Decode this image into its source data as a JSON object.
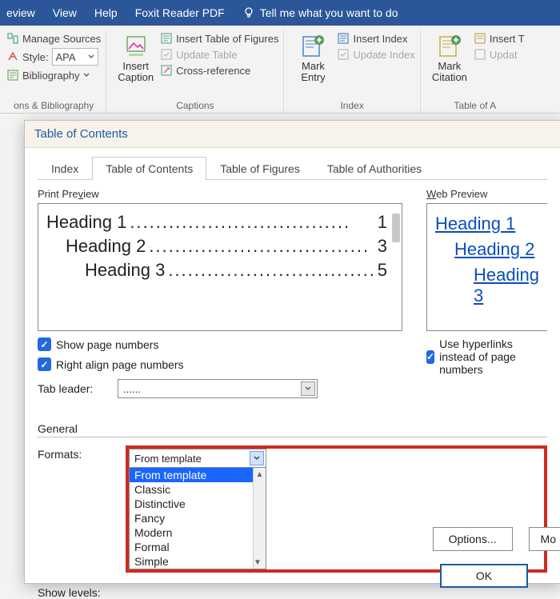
{
  "menubar": {
    "review": "eview",
    "view": "View",
    "help": "Help",
    "foxit": "Foxit Reader PDF",
    "tellme": "Tell me what you want to do"
  },
  "ribbon": {
    "citations": {
      "manage_sources": "Manage Sources",
      "style_label": "Style:",
      "style_value": "APA",
      "bibliography": "Bibliography",
      "group": "ons & Bibliography"
    },
    "captions": {
      "insert_caption_top": "Insert",
      "insert_caption_bot": "Caption",
      "insert_table": "Insert Table of Figures",
      "update_table": "Update Table",
      "cross_ref": "Cross-reference",
      "group": "Captions"
    },
    "index": {
      "mark_entry_top": "Mark",
      "mark_entry_bot": "Entry",
      "insert_index": "Insert Index",
      "update_index": "Update Index",
      "group": "Index"
    },
    "authorities": {
      "mark_citation_top": "Mark",
      "mark_citation_bot": "Citation",
      "insert_ta": "Insert T",
      "update_ta": "Updat",
      "group": "Table of A"
    }
  },
  "dialog": {
    "title": "Table of Contents",
    "tabs": {
      "index": "Index",
      "toc": "Table of Contents",
      "tof": "Table of Figures",
      "toa": "Table of Authorities"
    },
    "print_preview": "Print Preview",
    "web_preview": "Web Preview",
    "preview": {
      "h1": "Heading 1",
      "p1": "1",
      "h2": "Heading 2",
      "p2": "3",
      "h3": "Heading 3",
      "p3": "5",
      "leaders": ".................................."
    },
    "show_page_numbers": "Show page numbers",
    "right_align": "Right align page numbers",
    "use_hyperlinks": "Use hyperlinks instead of page numbers",
    "tab_leader_label": "Tab leader:",
    "tab_leader_value": "......",
    "general": "General",
    "formats_label": "Formats:",
    "formats_value": "From template",
    "format_options": [
      "From template",
      "Classic",
      "Distinctive",
      "Fancy",
      "Modern",
      "Formal",
      "Simple"
    ],
    "show_levels_label": "Show levels:",
    "options_btn": "Options...",
    "modify_btn": "Mo",
    "ok": "OK"
  }
}
